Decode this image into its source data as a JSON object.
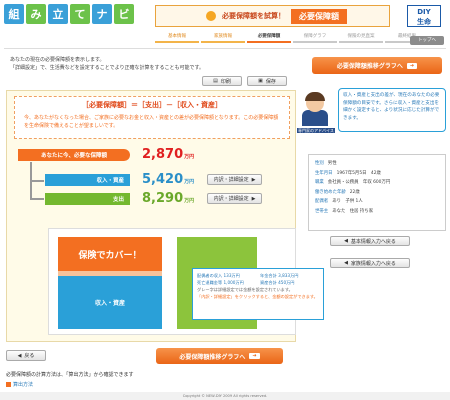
{
  "header": {
    "logo_chars": [
      "組",
      "み",
      "立",
      "て",
      "ナ",
      "ビ"
    ],
    "banner_sub": "必要保障額を試算！",
    "banner_tag": "必要保障額",
    "diy_line1": "DIY",
    "diy_line2": "生命"
  },
  "steps": [
    "基本情報",
    "家族情報",
    "必要保障額",
    "保障グラフ",
    "保険の見直案",
    "最終結果"
  ],
  "top_button": "トップへ",
  "intro": {
    "line1": "あなたの現在の必要保障額を表示します。",
    "line2": "「詳細設定」で、生活費などを設定することでより正確な計算をすることも可能です。"
  },
  "graph_button": "必要保障額推移グラフへ",
  "print_button": "印刷",
  "save_button": "保存",
  "formula": "［必要保障額］＝［支出］－［収入・資産］",
  "formula_note": "今、あなたがなくなった場合、ご家族に必要なお金と収入・資産との差が必要保障額となります。この必要保障額を生命保険で備えることが望ましいです。",
  "rows": [
    {
      "label": "あなたに今、必要な保障額",
      "amount": "2,870",
      "unit": "万円"
    },
    {
      "label": "収入・資産",
      "amount": "5,420",
      "unit": "万円",
      "detail": "内訳・詳細設定"
    },
    {
      "label": "支出",
      "amount": "8,290",
      "unit": "万円",
      "detail": "内訳・詳細設定"
    }
  ],
  "chart": {
    "cover_label": "保険でカバー！",
    "asset_label": "収入・資産"
  },
  "tooltip": {
    "items": [
      {
        "k": "配偶者の収入",
        "v": "133万円"
      },
      {
        "k": "年金合計",
        "v": "3,833万円"
      },
      {
        "k": "死亡退職金等",
        "v": "1,000万円"
      },
      {
        "k": "資産合計",
        "v": "450万円"
      }
    ],
    "note1": "グレー字は詳細設定では金額を設定されています。",
    "note2": "「内訳・詳細設定」をクリックすると、金額の設定ができます。"
  },
  "advisor_label": "専門家のアドバイス",
  "advice": "収入・資産と支出の差が、現在のあなたの必要保障額の目安です。さらに収入・資産と支出を細かく設定すると、より状況に応じた計算ができます。",
  "profile": [
    {
      "k": "性別",
      "v": "男性"
    },
    {
      "k": "生年月日",
      "v": "1967年5月5日　42歳"
    },
    {
      "k": "職業",
      "v": "会社員・公務員　年収 600万円"
    },
    {
      "k": "働き始めた年齢",
      "v": "22歳"
    },
    {
      "k": "配偶者",
      "v": "あり　子供 1人"
    },
    {
      "k": "世帯主",
      "v": "あなた　住居 持ち家"
    }
  ],
  "reinput_basic": "基本情報入力へ戻る",
  "reinput_family": "家族情報入力へ戻る",
  "back_button": "戻る",
  "footnote": "必要保障額の計算方法は、「算出方法」から確認できます",
  "calc_link": "算出方法",
  "copyright": "Copyright © NEW-DIY 2009 All rights reserved."
}
